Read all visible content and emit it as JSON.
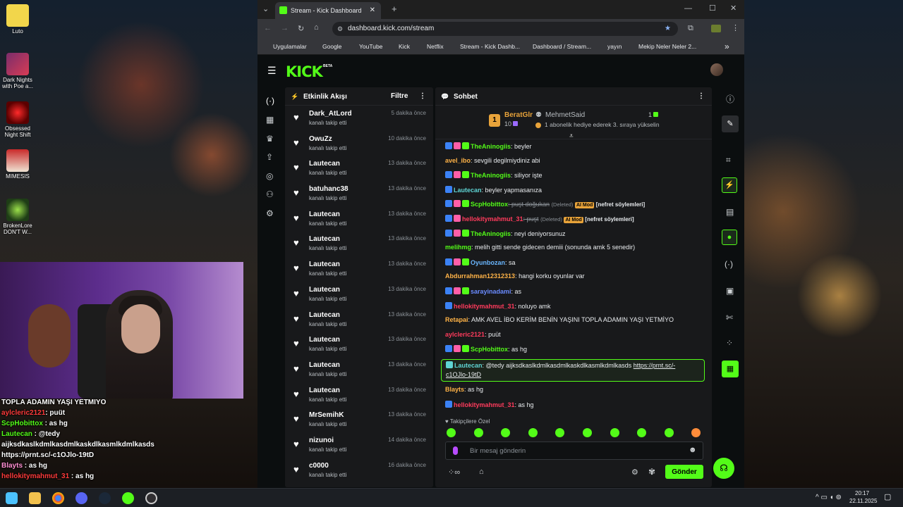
{
  "desktop": {
    "icons": [
      {
        "label": "Luto"
      },
      {
        "label": "Dark Nights with Poe a..."
      },
      {
        "label": "Obsessed Night Shift"
      },
      {
        "label": "MIMESIS"
      },
      {
        "label": "BrokenLore DON'T W..."
      }
    ]
  },
  "overlay_chat": {
    "line1": "TOPLA ADAMIN YAŞI YETMIYO",
    "line2_user": "aylcleric2121",
    "line2_msg": ": puüt",
    "line3_user": "ScpHobittox",
    "line3_msg": " : as hg",
    "line4_user": "Lautecan",
    "line4_msg": " : @tedy",
    "line5": "aijksdkaslkdmlkasdmlkaskdlkasmlkdmlkasds",
    "line6": "https://prnt.sc/-c1OJlo-19tD",
    "line7_user": "Blayts",
    "line7_msg": " : as hg",
    "line8_user": "hellokitymahmut_31",
    "line8_msg": " : as hg"
  },
  "browser": {
    "tab_title": "Stream - Kick Dashboard",
    "url": "dashboard.kick.com/stream",
    "bookmarks": [
      "Uygulamalar",
      "Google",
      "YouTube",
      "Kick",
      "Netflix",
      "Stream - Kick Dashb...",
      "Dashboard / Stream...",
      "yayın",
      "Mekip Neler Neler 2..."
    ]
  },
  "kick": {
    "logo": "KICK",
    "logo_beta": "BETA",
    "activity": {
      "title": "Etkinlik Akışı",
      "filter": "Filtre",
      "items": [
        {
          "name": "Dark_AtLord",
          "sub": "kanalı takip etti",
          "time": "5 dakika önce"
        },
        {
          "name": "OwuZz",
          "sub": "kanalı takip etti",
          "time": "10 dakika önce"
        },
        {
          "name": "Lautecan",
          "sub": "kanalı takip etti",
          "time": "13 dakika önce"
        },
        {
          "name": "batuhanc38",
          "sub": "kanalı takip etti",
          "time": "13 dakika önce"
        },
        {
          "name": "Lautecan",
          "sub": "kanalı takip etti",
          "time": "13 dakika önce"
        },
        {
          "name": "Lautecan",
          "sub": "kanalı takip etti",
          "time": "13 dakika önce"
        },
        {
          "name": "Lautecan",
          "sub": "kanalı takip etti",
          "time": "13 dakika önce"
        },
        {
          "name": "Lautecan",
          "sub": "kanalı takip etti",
          "time": "13 dakika önce"
        },
        {
          "name": "Lautecan",
          "sub": "kanalı takip etti",
          "time": "13 dakika önce"
        },
        {
          "name": "Lautecan",
          "sub": "kanalı takip etti",
          "time": "13 dakika önce"
        },
        {
          "name": "Lautecan",
          "sub": "kanalı takip etti",
          "time": "13 dakika önce"
        },
        {
          "name": "Lautecan",
          "sub": "kanalı takip etti",
          "time": "13 dakika önce"
        },
        {
          "name": "MrSemihK",
          "sub": "kanalı takip etti",
          "time": "13 dakika önce"
        },
        {
          "name": "nizunoi",
          "sub": "kanalı takip etti",
          "time": "14 dakika önce"
        },
        {
          "name": "c0000",
          "sub": "kanalı takip etti",
          "time": "16 dakika önce"
        }
      ]
    },
    "chat": {
      "title": "Sohbet",
      "pinned": {
        "rank": "1",
        "user1": "BeratGlr",
        "user1_count": "10",
        "user2": "MehmetSaid",
        "user2_count": "1",
        "note": "1 abonelik hediye ederek 3. sıraya yükselin"
      },
      "messages": [
        {
          "user": "TheAninogiis",
          "color": "#53fc18",
          "text": ": beyler"
        },
        {
          "user": "avel_ibo",
          "color": "#ffb347",
          "text": ": sevgili degilmiydiniz abi"
        },
        {
          "user": "TheAninogiis",
          "color": "#53fc18",
          "text": ": siliyor işte"
        },
        {
          "user": "Lautecan",
          "color": "#5fd4d4",
          "text": ": beyler yapmasanıza"
        },
        {
          "user": "ScpHobittox",
          "color": "#53fc18",
          "text": ": puşt doğukan",
          "deleted": "(Deleted)",
          "mod": "AI Mod",
          "reason": "[nefret söylemleri]"
        },
        {
          "user": "hellokitymahmut_31",
          "color": "#ff3b5c",
          "text": ": puşt",
          "deleted": "(Deleted)",
          "mod": "AI Mod",
          "reason": "[nefret söylemleri]"
        },
        {
          "user": "TheAninogiis",
          "color": "#53fc18",
          "text": ": neyi deniyorsunuz"
        },
        {
          "user": "melihmg",
          "color": "#53fc18",
          "text": ": melih gitti sende gidecen demiii (sonunda amk 5 senedir)"
        },
        {
          "user": "Oyunbozan",
          "color": "#6ab7ff",
          "text": ": sa"
        },
        {
          "user": "Abdurrahman12312313",
          "color": "#ffb347",
          "text": ": hangi korku oyunlar var"
        },
        {
          "user": "sarayinadami",
          "color": "#6a8bff",
          "text": ": as"
        },
        {
          "user": "hellokitymahmut_31",
          "color": "#ff3b5c",
          "text": ": noluyo amk"
        },
        {
          "user": "Retapai",
          "color": "#ffb347",
          "text": ": AMK AVEL İBO KERİM BENİN YAŞINI TOPLA ADAMIN YAŞI YETMİYO"
        },
        {
          "user": "aylcleric2121",
          "color": "#ff3b5c",
          "text": ": puüt"
        },
        {
          "user": "ScpHobittox",
          "color": "#53fc18",
          "text": ": as hg"
        }
      ],
      "highlight": {
        "user": "Lautecan",
        "text": ": @tedy aijksdkaslkdmlkasdmlkaskdlkasmlkdmlkasds ",
        "link1": "https://prnt.sc/-",
        "link2": "c1OJlo-19tD"
      },
      "after": [
        {
          "user": "Blayts",
          "color": "#ffb347",
          "text": ": as hg"
        },
        {
          "user": "hellokitymahmut_31",
          "color": "#ff3b5c",
          "text": ": as hg"
        }
      ],
      "followers_only": "Takipçilere Özel",
      "input_placeholder": "Bir mesaj gönderin",
      "send": "Gönder"
    }
  },
  "taskbar": {
    "time": "20:17",
    "date": "22.11.2025"
  }
}
